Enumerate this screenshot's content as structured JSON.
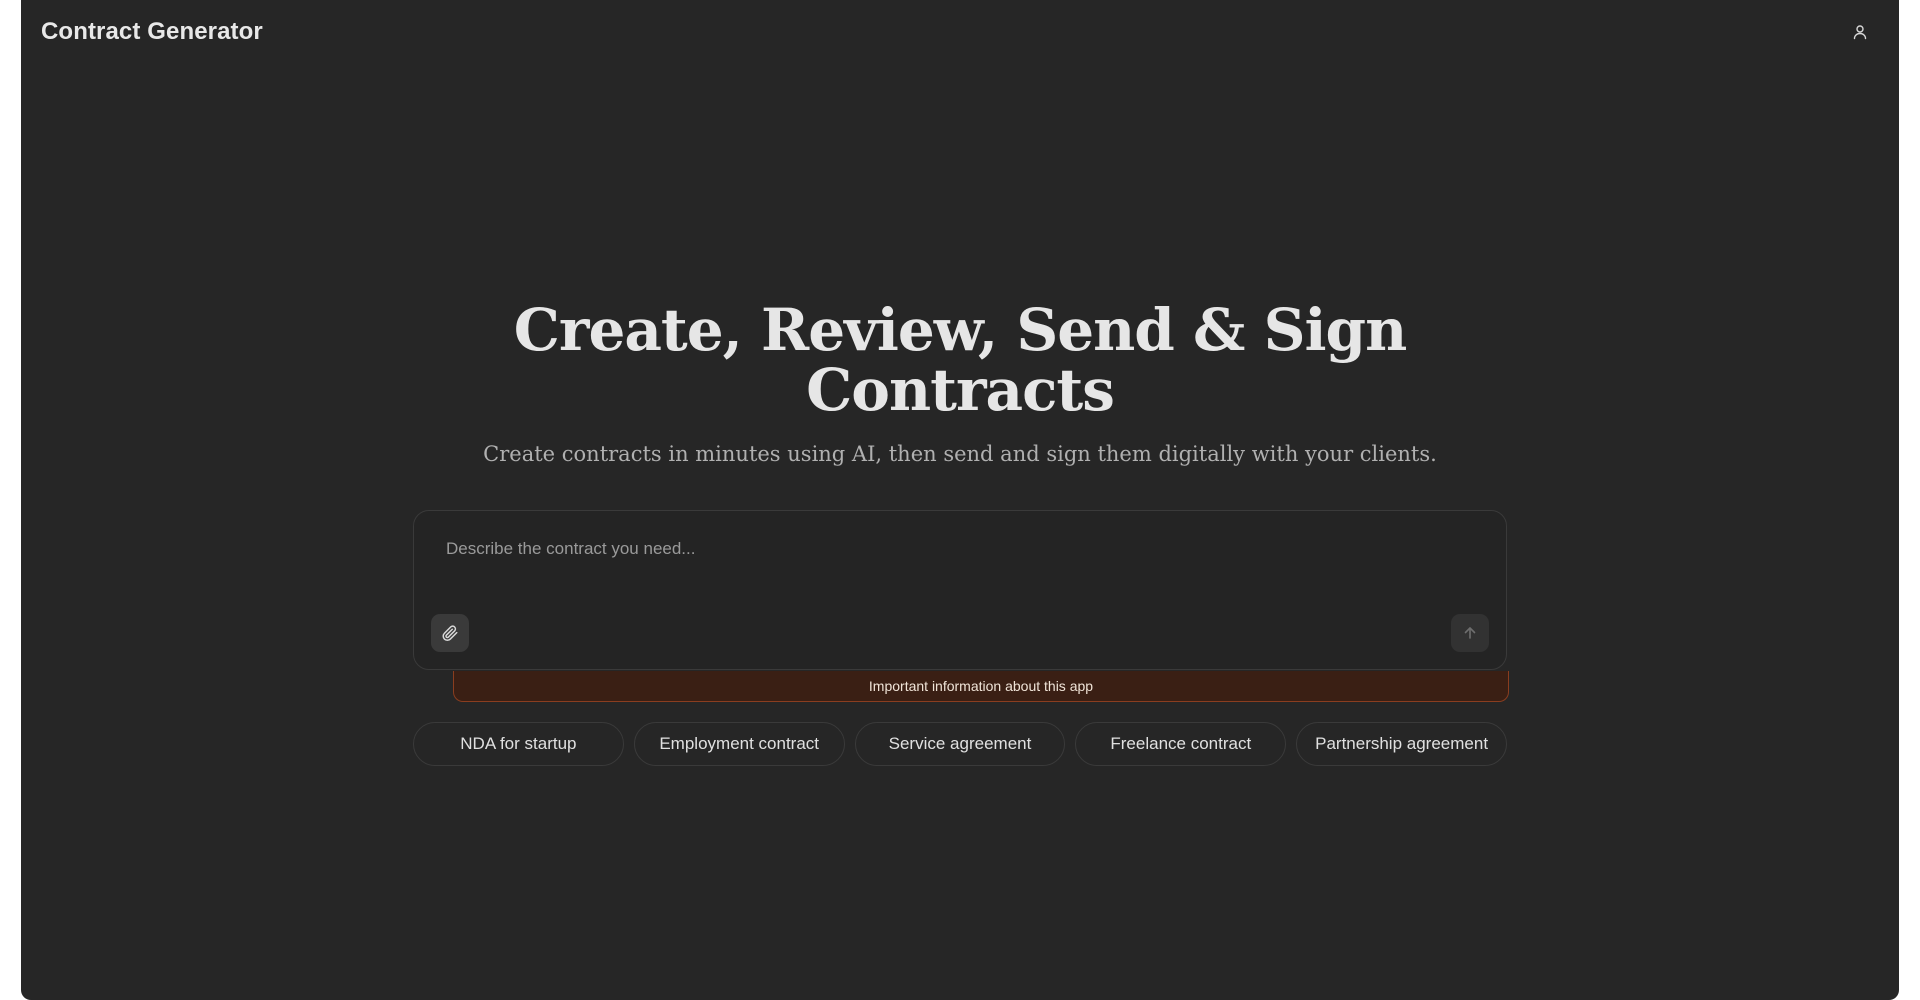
{
  "header": {
    "title": "Contract Generator",
    "user_icon": "user-icon"
  },
  "hero": {
    "title": "Create, Review, Send & Sign Contracts",
    "subtitle": "Create contracts in minutes using AI, then send and sign them digitally with your clients."
  },
  "composer": {
    "placeholder": "Describe the contract you need...",
    "value": "",
    "attach_icon": "paperclip-icon",
    "send_icon": "arrow-up-icon"
  },
  "notice": {
    "text": "Important information about this app",
    "colors": {
      "background": "#3a1f14",
      "border": "#8a3d1f"
    }
  },
  "suggestions": [
    {
      "label": "NDA for startup"
    },
    {
      "label": "Employment contract"
    },
    {
      "label": "Service agreement"
    },
    {
      "label": "Freelance contract"
    },
    {
      "label": "Partnership agreement"
    }
  ],
  "colors": {
    "app_background": "#262626",
    "text_primary": "#e6e6e6",
    "text_secondary": "#b0b0b0"
  }
}
